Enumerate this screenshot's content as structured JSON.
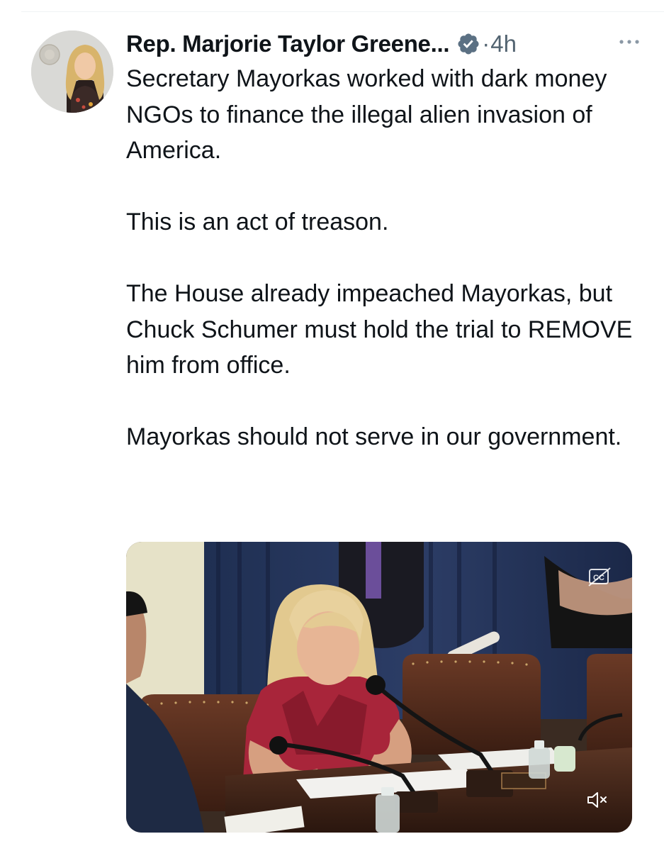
{
  "tweet": {
    "author_name": "Rep. Marjorie Taylor Greene...",
    "verified_icon": "verified-badge-icon",
    "separator": "·",
    "timestamp": "4h",
    "more_icon": "more-horizontal-icon",
    "paragraphs": [
      "Secretary Mayorkas worked with dark money NGOs to finance the illegal alien invasion of America.",
      "This is an act of treason.",
      "The House already impeached Mayorkas, but Chuck Schumer must hold the trial to REMOVE him from office.",
      "Mayorkas should not serve in our government."
    ]
  },
  "media": {
    "type": "video",
    "captions_icon": "closed-captions-icon",
    "mute_icon": "speaker-muted-icon"
  },
  "colors": {
    "text": "#0f1419",
    "secondary": "#536471",
    "verified_blue": "#5b7083",
    "divider": "#eff3f4"
  }
}
